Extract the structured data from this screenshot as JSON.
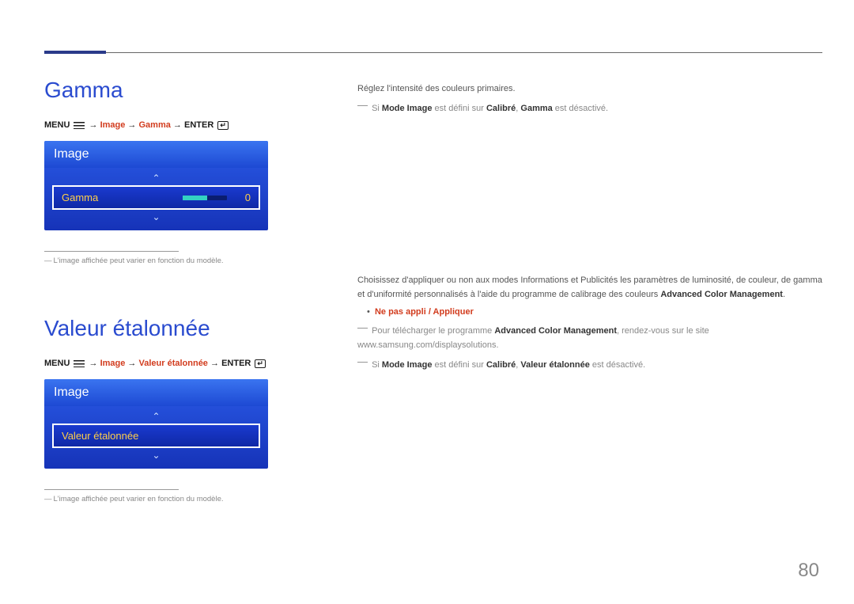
{
  "page_number": "80",
  "section_gamma": {
    "title": "Gamma",
    "breadcrumb": {
      "menu": "MENU",
      "seg1": "Image",
      "seg2": "Gamma",
      "enter": "ENTER"
    },
    "osd": {
      "header": "Image",
      "row_label": "Gamma",
      "row_value": "0"
    },
    "img_note": "L'image affichée peut varier en fonction du modèle.",
    "right": {
      "p1": "Réglez l'intensité des couleurs primaires.",
      "note1_pre": "Si ",
      "note1_b1": "Mode Image",
      "note1_mid": " est défini sur ",
      "note1_b2": "Calibré",
      "note1_sep": ", ",
      "note1_b3": "Gamma",
      "note1_post": " est désactivé."
    }
  },
  "section_valeur": {
    "title": "Valeur étalonnée",
    "breadcrumb": {
      "menu": "MENU",
      "seg1": "Image",
      "seg2": "Valeur étalonnée",
      "enter": "ENTER"
    },
    "osd": {
      "header": "Image",
      "row_label": "Valeur étalonnée"
    },
    "img_note": "L'image affichée peut varier en fonction du modèle.",
    "right": {
      "p1": "Choisissez d'appliquer ou non aux modes Informations et Publicités les paramètres de luminosité, de couleur, de gamma et d'uniformité personnalisés à l'aide du programme de calibrage des couleurs ",
      "p1_b": "Advanced Color Management",
      "p1_end": ".",
      "bullet_hl": "Ne pas appli / Appliquer",
      "note1_pre": "Pour télécharger le programme ",
      "note1_b": "Advanced Color Management",
      "note1_post": ", rendez-vous sur le site www.samsung.com/displaysolutions.",
      "note2_pre": "Si ",
      "note2_b1": "Mode Image",
      "note2_mid": " est défini sur ",
      "note2_b2": "Calibré",
      "note2_sep": ", ",
      "note2_b3": "Valeur étalonnée",
      "note2_post": " est désactivé."
    }
  }
}
